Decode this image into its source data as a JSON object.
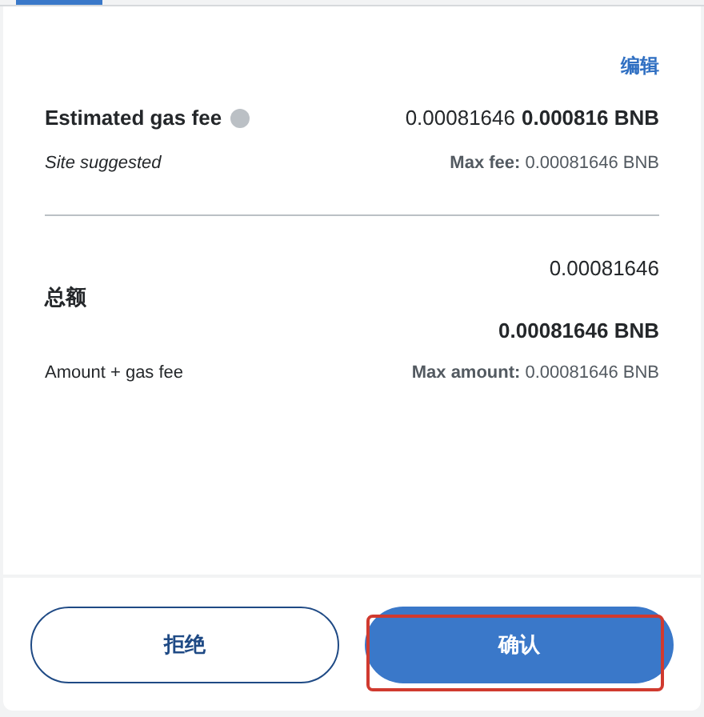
{
  "tabs": [
    {
      "selected": true
    }
  ],
  "edit_link": "编辑",
  "gas_fee": {
    "label": "Estimated gas fee",
    "sublabel": "Site suggested",
    "value": "0.00081646",
    "value_bold": "0.000816 BNB",
    "max_label": "Max fee:",
    "max_value": "0.00081646 BNB"
  },
  "total": {
    "label": "总额",
    "sublabel": "Amount + gas fee",
    "value": "0.00081646",
    "value_bold": "0.00081646 BNB",
    "max_label": "Max amount:",
    "max_value": "0.00081646 BNB"
  },
  "buttons": [
    {
      "label": "拒绝",
      "kind": "outline",
      "highlighted": false
    },
    {
      "label": "确认",
      "kind": "primary",
      "highlighted": true
    }
  ]
}
